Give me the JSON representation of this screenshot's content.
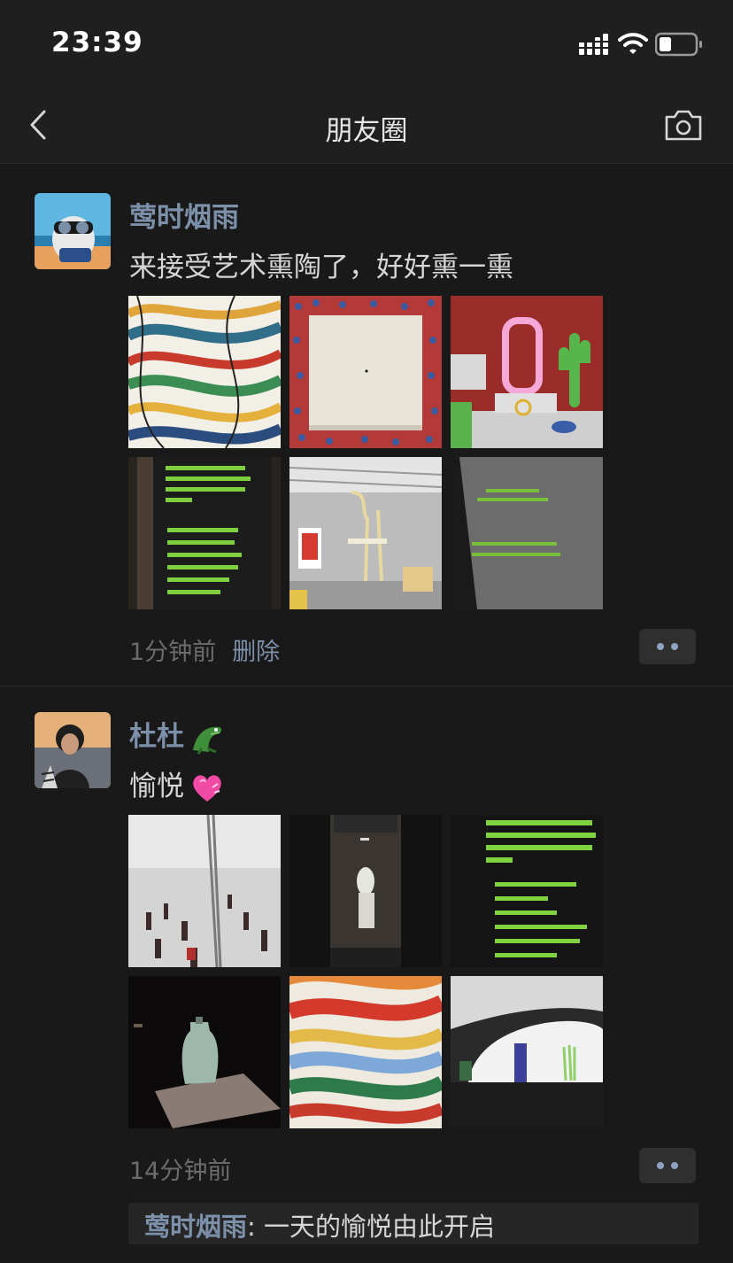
{
  "status_bar": {
    "time": "23:39"
  },
  "nav": {
    "title": "朋友圈"
  },
  "posts": [
    {
      "author": "莺时烟雨",
      "text": "来接受艺术熏陶了，好好熏一熏",
      "time": "1分钟前",
      "delete_label": "删除",
      "photos": [
        "wave-pattern-painting",
        "white-canvas-red-blue-frame",
        "pink-mirror-cactus-installation",
        "green-text-wall-1",
        "yellow-chair-gallery",
        "green-text-wall-2"
      ]
    },
    {
      "author": "杜杜",
      "author_emoji": "crocodile",
      "text": "愉悦",
      "text_emoji": "pink-heart",
      "time": "14分钟前",
      "photos": [
        "white-gallery-visitors",
        "dark-statue-room",
        "green-text-wall-3",
        "glass-vase-dark",
        "colorful-wave-painting",
        "white-dome-objects"
      ],
      "comments": [
        {
          "author": "莺时烟雨",
          "separator": ": ",
          "text": "一天的愉悦由此开启"
        }
      ]
    }
  ],
  "colors": {
    "background": "#191919",
    "link": "#7d90a9",
    "text": "#d6d6d6",
    "muted": "#6c6c6c"
  }
}
